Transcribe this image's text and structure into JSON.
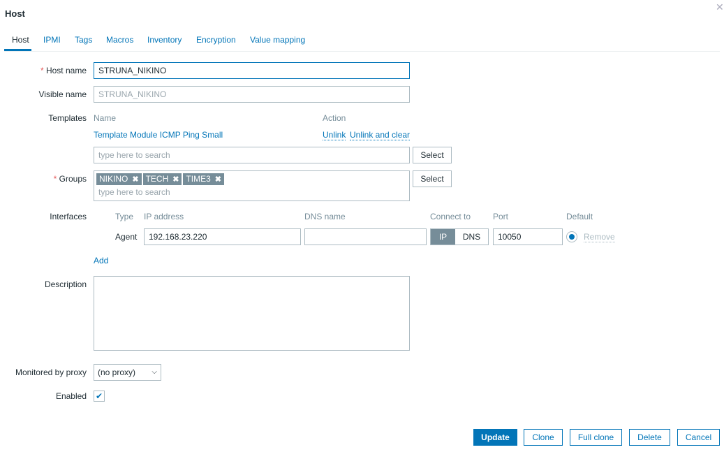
{
  "dialog": {
    "title": "Host",
    "close_icon": "close-icon"
  },
  "tabs": [
    "Host",
    "IPMI",
    "Tags",
    "Macros",
    "Inventory",
    "Encryption",
    "Value mapping"
  ],
  "form": {
    "host_name": {
      "label": "Host name",
      "value": "STRUNA_NIKINO"
    },
    "visible_name": {
      "label": "Visible name",
      "placeholder": "STRUNA_NIKINO"
    },
    "templates": {
      "label": "Templates",
      "col_name": "Name",
      "col_action": "Action",
      "items": [
        {
          "name": "Template Module ICMP Ping Small",
          "unlink": "Unlink",
          "unlink_clear": "Unlink and clear"
        }
      ],
      "search_placeholder": "type here to search",
      "select": "Select"
    },
    "groups": {
      "label": "Groups",
      "tags": [
        "NIKINO",
        "TECH",
        "TIME3"
      ],
      "search_placeholder": "type here to search",
      "select": "Select"
    },
    "interfaces": {
      "label": "Interfaces",
      "headers": [
        "Type",
        "IP address",
        "DNS name",
        "Connect to",
        "Port",
        "Default"
      ],
      "rows": [
        {
          "type": "Agent",
          "ip": "192.168.23.220",
          "dns": "",
          "connect_ip": "IP",
          "connect_dns": "DNS",
          "port": "10050",
          "remove": "Remove"
        }
      ],
      "add": "Add"
    },
    "description": {
      "label": "Description",
      "value": ""
    },
    "proxy": {
      "label": "Monitored by proxy",
      "value": "(no proxy)"
    },
    "enabled": {
      "label": "Enabled",
      "checked": true
    }
  },
  "buttons": {
    "update": "Update",
    "clone": "Clone",
    "full_clone": "Full clone",
    "delete": "Delete",
    "cancel": "Cancel"
  },
  "colors": {
    "accent": "#0275b8",
    "tag": "#768d99",
    "required": "#e45959"
  }
}
